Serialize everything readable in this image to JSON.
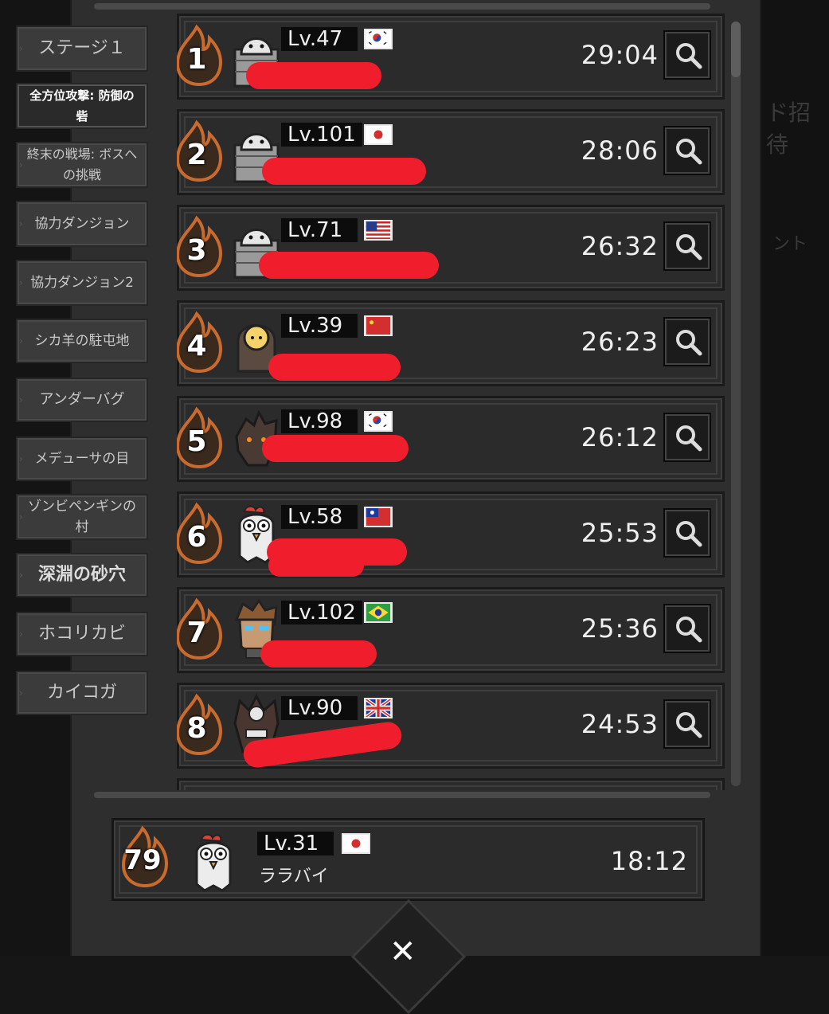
{
  "tabs": [
    {
      "label": "ステージ１",
      "active": false
    },
    {
      "label": "全方位攻撃: 防御の砦",
      "active": true
    },
    {
      "label": "終末の戦場: ボスへの挑戦",
      "active": false
    },
    {
      "label": "協力ダンジョン",
      "active": false
    },
    {
      "label": "協力ダンジョン2",
      "active": false
    },
    {
      "label": "シカ羊の駐屯地",
      "active": false
    },
    {
      "label": "アンダーバグ",
      "active": false
    },
    {
      "label": "メデューサの目",
      "active": false
    },
    {
      "label": "ゾンビペンギンの村",
      "active": false
    },
    {
      "label": "深淵の砂穴",
      "active": false
    },
    {
      "label": "ホコリカビ",
      "active": false
    },
    {
      "label": "カイコガ",
      "active": false
    }
  ],
  "background_text": {
    "right_1": "ド招待",
    "right_2": "ント"
  },
  "ranking": [
    {
      "rank": "1",
      "level": "Lv.47",
      "flag": "korea",
      "time": "29:04",
      "avatar": "ghost-icon"
    },
    {
      "rank": "2",
      "level": "Lv.101",
      "flag": "japan",
      "time": "28:06",
      "avatar": "ghost-icon"
    },
    {
      "rank": "3",
      "level": "Lv.71",
      "flag": "usa",
      "time": "26:32",
      "avatar": "ghost-icon"
    },
    {
      "rank": "4",
      "level": "Lv.39",
      "flag": "china",
      "time": "26:23",
      "avatar": "hooded-icon"
    },
    {
      "rank": "5",
      "level": "Lv.98",
      "flag": "korea",
      "time": "26:12",
      "avatar": "rock-golem-icon"
    },
    {
      "rank": "6",
      "level": "Lv.58",
      "flag": "taiwan",
      "time": "25:53",
      "avatar": "chicken-icon"
    },
    {
      "rank": "7",
      "level": "Lv.102",
      "flag": "brazil",
      "time": "25:36",
      "avatar": "hero-icon"
    },
    {
      "rank": "8",
      "level": "Lv.90",
      "flag": "uk",
      "time": "24:53",
      "avatar": "skull-knight-icon"
    }
  ],
  "own": {
    "rank": "79",
    "level": "Lv.31",
    "flag": "japan",
    "name": "ララバイ",
    "time": "18:12",
    "avatar": "chicken-icon"
  },
  "colors": {
    "scribble": "#f01e2c",
    "flame": "#c96a2e",
    "panel": "#2e2e2e"
  }
}
